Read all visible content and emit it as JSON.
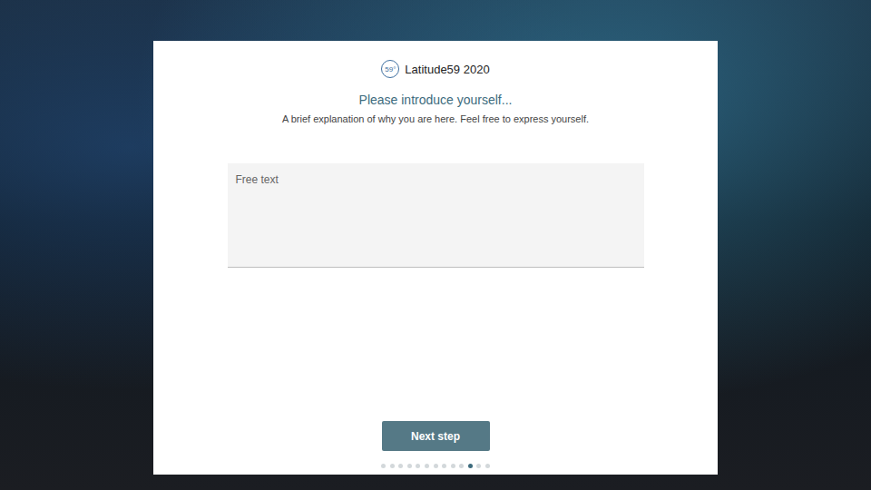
{
  "logo": {
    "mark": "59°",
    "name": "Latitude59 2020"
  },
  "form": {
    "heading": "Please introduce yourself...",
    "subheading": "A brief explanation of why you are here. Feel free to express yourself.",
    "field": {
      "placeholder": "Free text",
      "value": ""
    }
  },
  "buttons": [
    "Next step"
  ],
  "steps": [
    {
      "selected": false
    },
    {
      "selected": false
    },
    {
      "selected": false
    },
    {
      "selected": false
    },
    {
      "selected": false
    },
    {
      "selected": false
    },
    {
      "selected": false
    },
    {
      "selected": false
    },
    {
      "selected": false
    },
    {
      "selected": false
    },
    {
      "selected": true
    },
    {
      "selected": false
    },
    {
      "selected": false
    }
  ]
}
